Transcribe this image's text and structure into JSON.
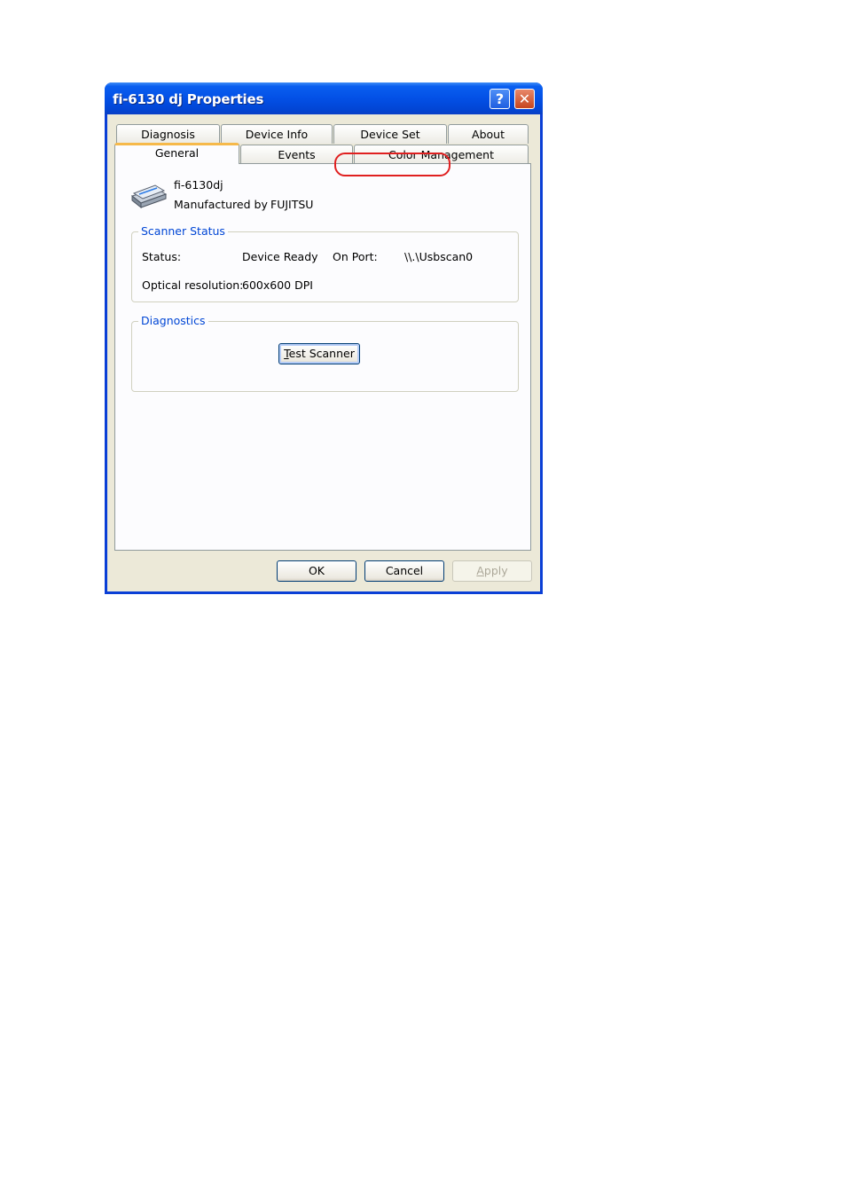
{
  "window": {
    "title": "fi-6130 dj Properties",
    "help_glyph": "?",
    "close_glyph": "✕"
  },
  "tabs": {
    "row1": [
      {
        "label": "Diagnosis"
      },
      {
        "label": "Device Info"
      },
      {
        "label": "Device Set"
      },
      {
        "label": "About"
      }
    ],
    "row2": [
      {
        "label": "General",
        "selected": true
      },
      {
        "label": "Events"
      },
      {
        "label": "Color Management"
      }
    ],
    "highlighted_tab": "Device Set",
    "highlight_color": "#e02020"
  },
  "device": {
    "icon": "scanner-icon",
    "name": "fi-6130dj",
    "manufacturer_label": "Manufactured by",
    "manufacturer": "FUJITSU"
  },
  "scanner_status": {
    "legend": "Scanner Status",
    "status_label": "Status:",
    "status_value": "Device Ready",
    "port_label": "On Port:",
    "port_value": "\\\\.\\Usbscan0",
    "resolution_label": "Optical resolution:",
    "resolution_value": "600x600 DPI"
  },
  "diagnostics": {
    "legend": "Diagnostics",
    "test_button": "Test Scanner",
    "test_button_mnemonic": "T",
    "test_button_rest": "est Scanner"
  },
  "footer": {
    "ok": "OK",
    "cancel": "Cancel",
    "apply": "Apply",
    "apply_mnemonic": "A",
    "apply_rest": "pply",
    "apply_enabled": false
  },
  "colors": {
    "title_bar": "#0350e6",
    "group_legend": "#0046d5",
    "dialog_bg": "#ece9d8",
    "selected_tab_accent": "#f6b94a"
  }
}
